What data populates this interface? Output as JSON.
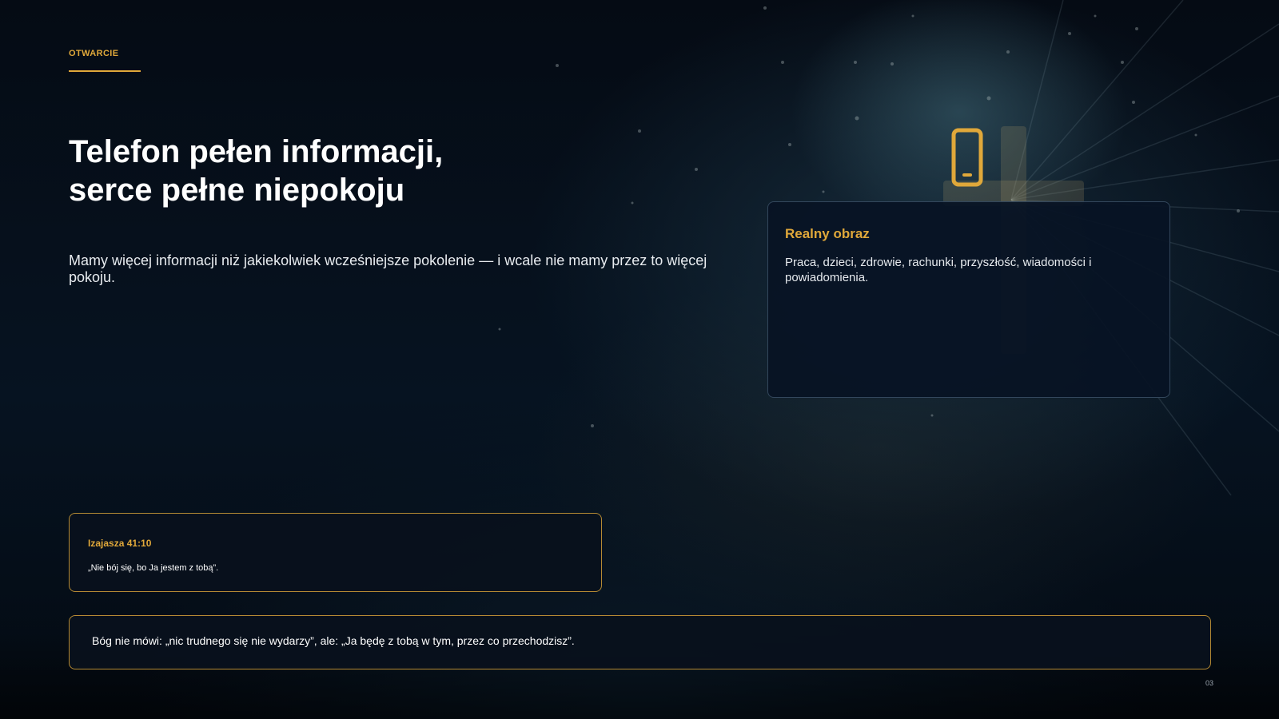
{
  "slide": {
    "overline": "OTWARCIE",
    "title_lines": [
      "Telefon pełen informacji,",
      "serce pełne niepokoju"
    ],
    "lead": "Mamy więcej informacji niż jakiekolwiek wcześniejsze pokolenie — i wcale nie mamy przez to więcej pokoju.",
    "page_number": "03"
  },
  "illustration": {
    "icon": "phone-icon"
  },
  "card_real": {
    "title": "Realny obraz",
    "body": "Praca, dzieci, zdrowie, rachunki, przyszłość, wiadomości i powiadomienia."
  },
  "verse_card": {
    "reference": "Izajasza 41:10",
    "text": "„Nie bój się, bo Ja jestem z tobą”."
  },
  "note_card": {
    "text": "Bóg nie mówi: „nic trudnego się nie wydarzy”, ale: „Ja będę z tobą w tym, przez co przechodzisz”."
  },
  "colors": {
    "accent": "#e0a83a",
    "background": "#050c16",
    "card_border": "#33475c",
    "gold_border": "#b58a33",
    "text": "#ffffff"
  }
}
